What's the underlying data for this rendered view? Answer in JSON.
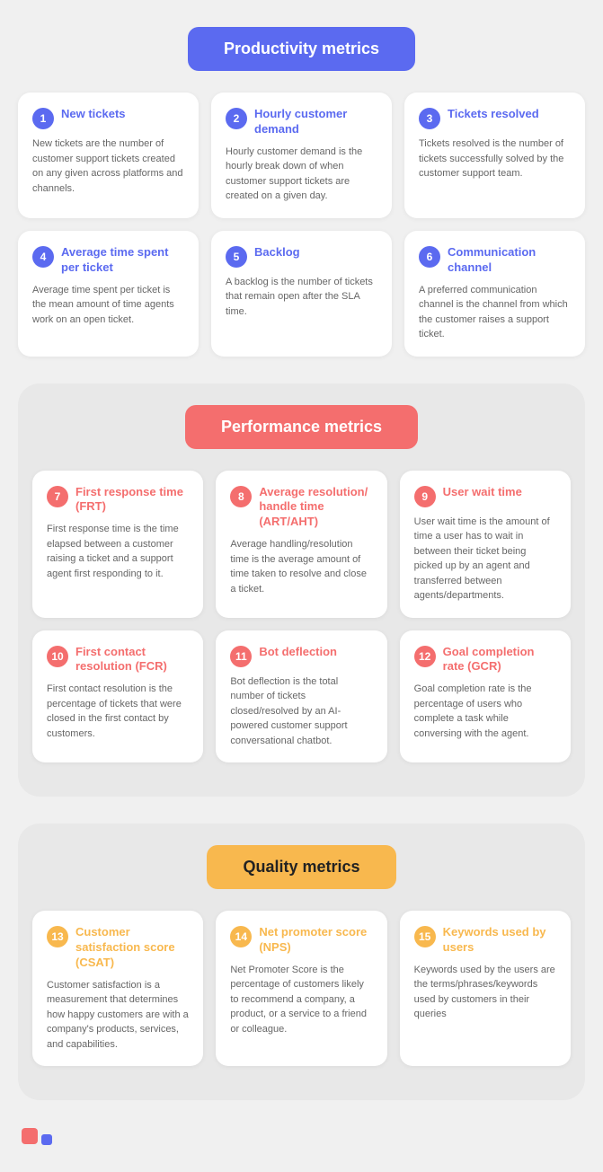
{
  "sections": [
    {
      "id": "productivity",
      "badge_label": "Productivity metrics",
      "badge_style": "badge-blue",
      "num_style": "num-blue",
      "title_style": "title-blue",
      "rows": [
        [
          {
            "num": "1",
            "title": "New tickets",
            "desc": "New tickets are the number of customer support tickets created on any given across platforms and channels."
          },
          {
            "num": "2",
            "title": "Hourly customer demand",
            "desc": "Hourly customer demand is the hourly break down of when customer support tickets are created on a given day."
          },
          {
            "num": "3",
            "title": "Tickets resolved",
            "desc": "Tickets resolved is the number of tickets successfully solved by the customer support team."
          }
        ],
        [
          {
            "num": "4",
            "title": "Average time spent per ticket",
            "desc": "Average time spent per ticket is the mean amount of time agents work on an open ticket."
          },
          {
            "num": "5",
            "title": "Backlog",
            "desc": "A backlog is the number of tickets that remain open after the SLA time."
          },
          {
            "num": "6",
            "title": "Communication channel",
            "desc": "A preferred communication channel is the channel from which the customer raises a support ticket."
          }
        ]
      ]
    },
    {
      "id": "performance",
      "badge_label": "Performance metrics",
      "badge_style": "badge-red",
      "num_style": "num-red",
      "title_style": "title-red",
      "rows": [
        [
          {
            "num": "7",
            "title": "First response time (FRT)",
            "desc": "First response time is the time elapsed between a customer raising a ticket and a support agent first responding to it."
          },
          {
            "num": "8",
            "title": "Average resolution/ handle time (ART/AHT)",
            "desc": "Average handling/resolution time is the average amount of time taken to resolve and close a ticket."
          },
          {
            "num": "9",
            "title": "User wait time",
            "desc": "User wait time is the amount of time a user has to wait in between their ticket being picked up by an agent and transferred between agents/departments."
          }
        ],
        [
          {
            "num": "10",
            "title": "First contact resolution (FCR)",
            "desc": "First contact resolution is the percentage of tickets that were closed in the first contact by customers."
          },
          {
            "num": "11",
            "title": "Bot deflection",
            "desc": "Bot deflection is the total number of tickets closed/resolved by an AI-powered customer support conversational chatbot."
          },
          {
            "num": "12",
            "title": "Goal completion rate (GCR)",
            "desc": "Goal completion rate is the percentage of users who complete a task while conversing with the agent."
          }
        ]
      ]
    },
    {
      "id": "quality",
      "badge_label": "Quality metrics",
      "badge_style": "badge-orange",
      "num_style": "num-orange",
      "title_style": "title-orange",
      "rows": [
        [
          {
            "num": "13",
            "title": "Customer satisfaction score (CSAT)",
            "desc": "Customer satisfaction is a measurement that determines how happy customers are with a company's products, services, and capabilities."
          },
          {
            "num": "14",
            "title": "Net promoter score (NPS)",
            "desc": "Net Promoter Score is the percentage of customers likely to recommend a company, a product, or a service to a friend or colleague."
          },
          {
            "num": "15",
            "title": "Keywords used by users",
            "desc": "Keywords used by the users are the terms/phrases/keywords used by customers in their queries"
          }
        ]
      ]
    }
  ]
}
